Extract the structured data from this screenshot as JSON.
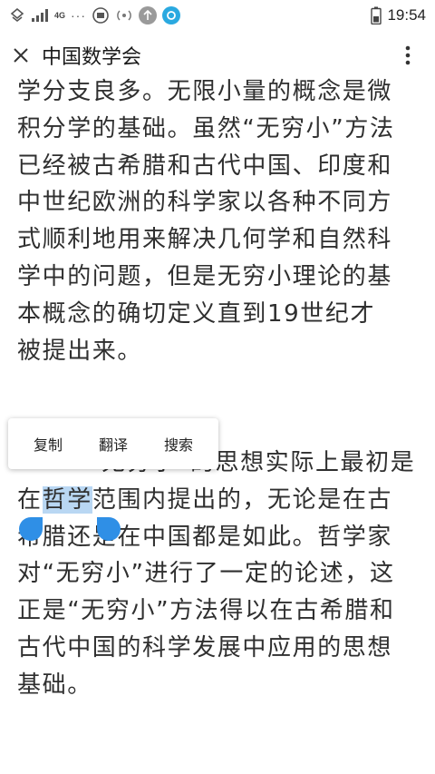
{
  "status_bar": {
    "network_label": "4G",
    "more_dots": "···",
    "time": "19:54",
    "icons": [
      "sim-icon",
      "signal-icon",
      "data-icon",
      "notification-icon",
      "wifi-hotspot-icon",
      "upload-icon",
      "app-icon",
      "battery-icon"
    ]
  },
  "header": {
    "close_icon": "close-icon",
    "title": "中国数学会",
    "more_icon": "more-vertical-icon"
  },
  "article": {
    "paragraph1_lines": [
      "学分支良多。无限小量的概念是微",
      "积分学的基础。虽然“无穷小”方法",
      "已经被古希腊和古代中国、印度和",
      "中世纪欧洲的科学家以各种不同方",
      "式顺利地用来解决几何学和自然科",
      "学中的问题，但是无穷小理论的基",
      "本概念的确切定义直到19世纪才",
      "被提出来。"
    ],
    "paragraph2": {
      "line1": "“无穷小”的思想实际上最初是",
      "line2_prefix": "在",
      "line2_selected": "哲学",
      "line2_suffix": "范围内提出的，无论是在古",
      "rest_lines": [
        "希腊还是在中国都是如此。哲学家",
        "对“无穷小”进行了一定的论述，这",
        "正是“无穷小”方法得以在古希腊和",
        "古代中国的科学发展中应用的思想",
        "基础。"
      ]
    }
  },
  "selection_popup": {
    "copy": "复制",
    "translate": "翻译",
    "search": "搜索"
  },
  "colors": {
    "selection_highlight": "#b9d7f3",
    "selection_handle": "#2f8fe6",
    "text": "#2f2f2f"
  }
}
